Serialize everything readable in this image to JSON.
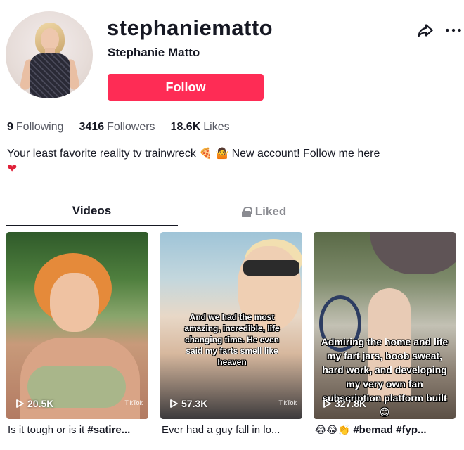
{
  "profile": {
    "username": "stephaniematto",
    "nickname": "Stephanie Matto",
    "follow_label": "Follow"
  },
  "stats": {
    "following_count": "9",
    "following_label": "Following",
    "followers_count": "3416",
    "followers_label": "Followers",
    "likes_count": "18.6K",
    "likes_label": "Likes"
  },
  "bio": {
    "text_before": "Your least favorite reality tv trainwreck",
    "emoji_1": "🍕",
    "emoji_2": "🤷",
    "text_after": "New account! Follow me here",
    "heart": "❤"
  },
  "tabs": {
    "videos_label": "Videos",
    "liked_label": "Liked",
    "active": "Videos"
  },
  "videos": [
    {
      "views": "20.5K",
      "overlay_text": "",
      "watermark": "TikTok",
      "caption_text": "Is it tough or is it ",
      "caption_tag": "#satire..."
    },
    {
      "views": "57.3K",
      "overlay_text": "And we had the most amazing, incredible, life changing time. He even said my farts smell like heaven",
      "watermark": "TikTok",
      "caption_text": "Ever had a guy fall in lo...",
      "caption_tag": ""
    },
    {
      "views": "327.8K",
      "overlay_text": "Admiring the home and life my fart jars, boob sweat, hard work, and developing my very own fan subscription platform built😊",
      "watermark": "",
      "caption_emoji": "😂😂👏",
      "caption_tag": "#bemad #fyp..."
    }
  ],
  "colors": {
    "accent": "#fe2c55",
    "text_primary": "#161823",
    "text_secondary": "#555761"
  },
  "icons": [
    "share-icon",
    "more-icon",
    "lock-icon",
    "play-icon"
  ]
}
